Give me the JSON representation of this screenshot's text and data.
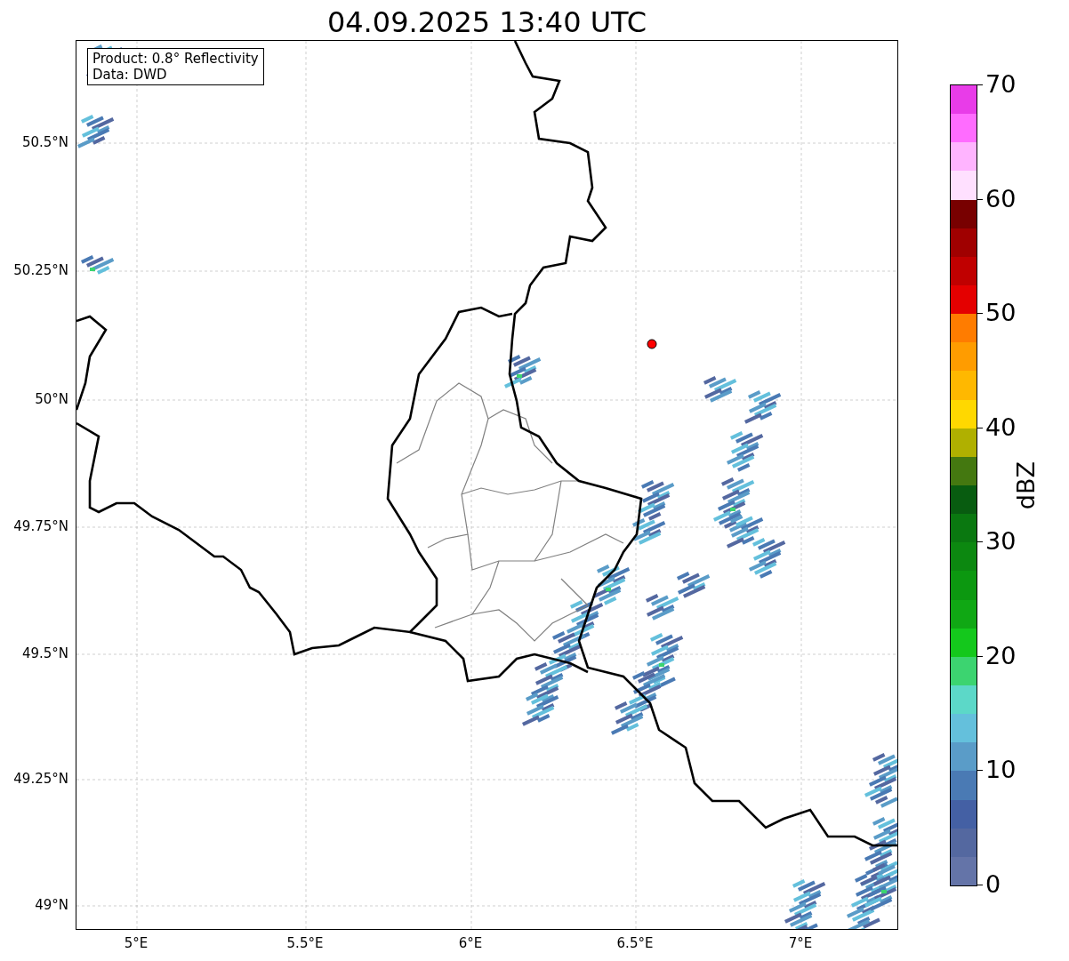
{
  "title": "04.09.2025 13:40 UTC",
  "map": {
    "info_box": [
      "Product: 0.8° Reflectivity",
      "Data: DWD"
    ],
    "lat_ticks": [
      "50.5°N",
      "50.25°N",
      "50°N",
      "49.75°N",
      "49.5°N",
      "49.25°N",
      "49°N"
    ],
    "lon_ticks": [
      "5°E",
      "5.5°E",
      "6°E",
      "6.5°E",
      "7°E"
    ]
  },
  "colorbar": {
    "label": "dBZ",
    "ticks": [
      "70",
      "60",
      "50",
      "40",
      "30",
      "20",
      "10",
      "0"
    ],
    "bands": [
      {
        "color": "#6474a8"
      },
      {
        "color": "#5468a0"
      },
      {
        "color": "#4460a4"
      },
      {
        "color": "#4a7ab4"
      },
      {
        "color": "#5a9cc8"
      },
      {
        "color": "#64c0dc"
      },
      {
        "color": "#5cd8c8"
      },
      {
        "color": "#3cd470"
      },
      {
        "color": "#14c81c"
      },
      {
        "color": "#10a814"
      },
      {
        "color": "#0c9810"
      },
      {
        "color": "#0c8810"
      },
      {
        "color": "#0a7810"
      },
      {
        "color": "#085c10"
      },
      {
        "color": "#447810"
      },
      {
        "color": "#b0b000"
      },
      {
        "color": "#ffd800"
      },
      {
        "color": "#ffb800"
      },
      {
        "color": "#ff9c00"
      },
      {
        "color": "#ff7c00"
      },
      {
        "color": "#e40000"
      },
      {
        "color": "#c00000"
      },
      {
        "color": "#a00000"
      },
      {
        "color": "#780000"
      },
      {
        "color": "#ffe0ff"
      },
      {
        "color": "#ffb4ff"
      },
      {
        "color": "#ff6cff"
      },
      {
        "color": "#e83ce8"
      }
    ]
  }
}
